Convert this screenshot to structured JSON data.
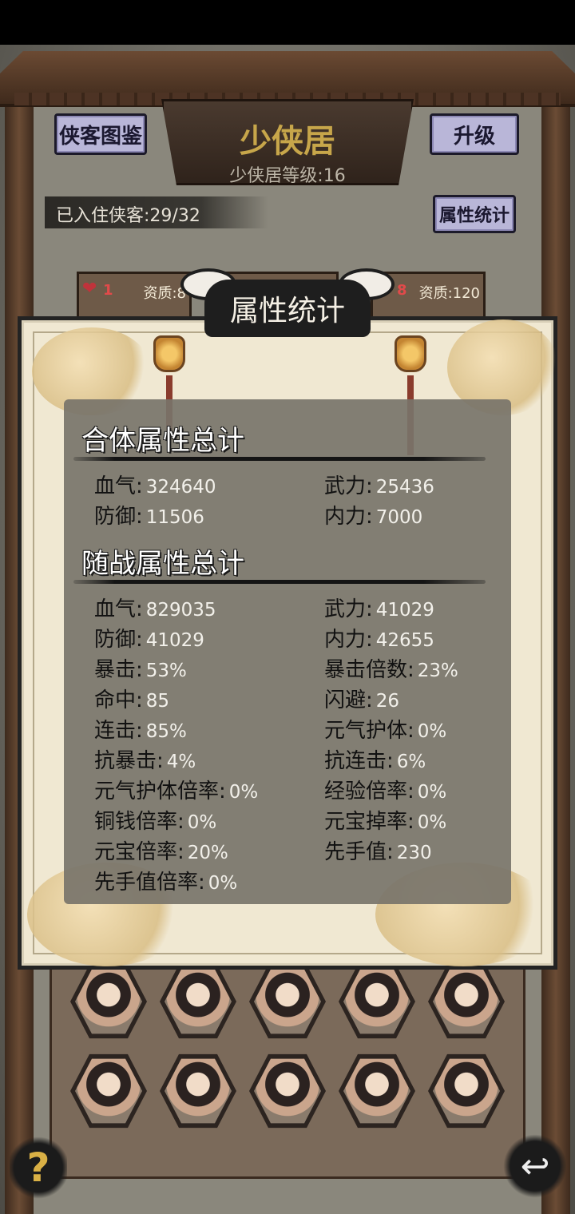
{
  "header": {
    "heroes_book_button": "侠客图鉴",
    "title": "少侠居",
    "level_text": "少侠居等级:16",
    "upgrade_button": "升级",
    "residents_text": "已入住侠客:29/32",
    "stats_button": "属性统计"
  },
  "cards": [
    {
      "hearts": "1",
      "aptitude": "资质:8"
    },
    {
      "hearts": "",
      "aptitude": ""
    },
    {
      "hearts": "8",
      "aptitude": "资质:120"
    }
  ],
  "modal": {
    "title": "属性统计",
    "combined_section": {
      "title": "合体属性总计",
      "stats": [
        {
          "label": "血气:",
          "value": "324640"
        },
        {
          "label": "武力:",
          "value": "25436"
        },
        {
          "label": "防御:",
          "value": "11506"
        },
        {
          "label": "内力:",
          "value": "7000"
        }
      ]
    },
    "follower_section": {
      "title": "随战属性总计",
      "stats": [
        {
          "label": "血气:",
          "value": "829035"
        },
        {
          "label": "武力:",
          "value": "41029"
        },
        {
          "label": "防御:",
          "value": "41029"
        },
        {
          "label": "内力:",
          "value": "42655"
        },
        {
          "label": "暴击:",
          "value": "53%"
        },
        {
          "label": "暴击倍数:",
          "value": "23%"
        },
        {
          "label": "命中:",
          "value": "85"
        },
        {
          "label": "闪避:",
          "value": "26"
        },
        {
          "label": "连击:",
          "value": "85%"
        },
        {
          "label": "元气护体:",
          "value": "0%"
        },
        {
          "label": "抗暴击:",
          "value": "4%"
        },
        {
          "label": "抗连击:",
          "value": "6%"
        },
        {
          "label": "元气护体倍率:",
          "value": "0%"
        },
        {
          "label": "经验倍率:",
          "value": "0%"
        },
        {
          "label": "铜钱倍率:",
          "value": "0%"
        },
        {
          "label": "元宝掉率:",
          "value": "0%"
        },
        {
          "label": "元宝倍率:",
          "value": "20%"
        },
        {
          "label": "先手值:",
          "value": "230"
        },
        {
          "label": "先手值倍率:",
          "value": "0%"
        }
      ]
    }
  },
  "footer": {
    "help_icon": "question-mark",
    "help_label": "?",
    "back_icon": "return-arrow",
    "back_label": "↩"
  }
}
